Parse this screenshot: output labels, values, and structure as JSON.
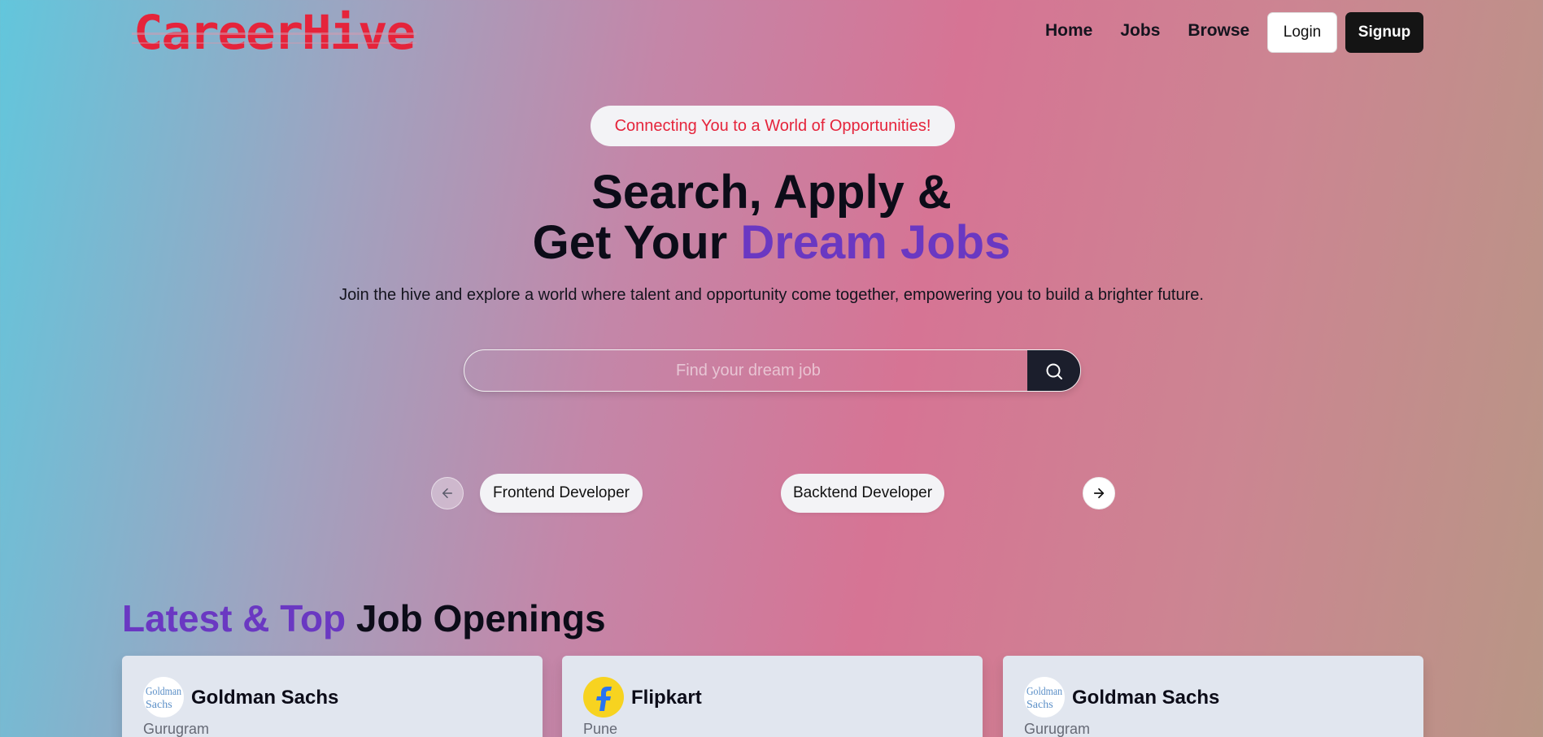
{
  "brand": {
    "logo_text": "CareerHive",
    "logo_color": "#e5243b"
  },
  "nav": {
    "links": [
      "Home",
      "Jobs",
      "Browse"
    ],
    "login_label": "Login",
    "signup_label": "Signup"
  },
  "hero": {
    "tagline": "Connecting You to a World of Opportunities!",
    "title_line1": "Search, Apply &",
    "title_line2_plain": "Get Your ",
    "title_line2_accent": "Dream Jobs",
    "subtitle": "Join the hive and explore a world where talent and opportunity come together, empowering you to build a brighter future.",
    "search_placeholder": "Find your dream job",
    "search_icon": "search-icon"
  },
  "carousel": {
    "prev_icon": "arrow-left-icon",
    "next_icon": "arrow-right-icon",
    "items": [
      "Frontend Developer",
      "Backtend Developer"
    ]
  },
  "latest": {
    "title_accent": "Latest & Top",
    "title_plain": " Job Openings",
    "jobs": [
      {
        "company": "Goldman Sachs",
        "location": "Gurugram",
        "logo_icon": "goldman-sachs-logo-icon"
      },
      {
        "company": "Flipkart",
        "location": "Pune",
        "logo_icon": "flipkart-logo-icon"
      },
      {
        "company": "Goldman Sachs",
        "location": "Gurugram",
        "logo_icon": "goldman-sachs-logo-icon"
      }
    ]
  },
  "colors": {
    "accent": "#6a38c2",
    "brand_red": "#e5243b",
    "dark": "#141414"
  }
}
